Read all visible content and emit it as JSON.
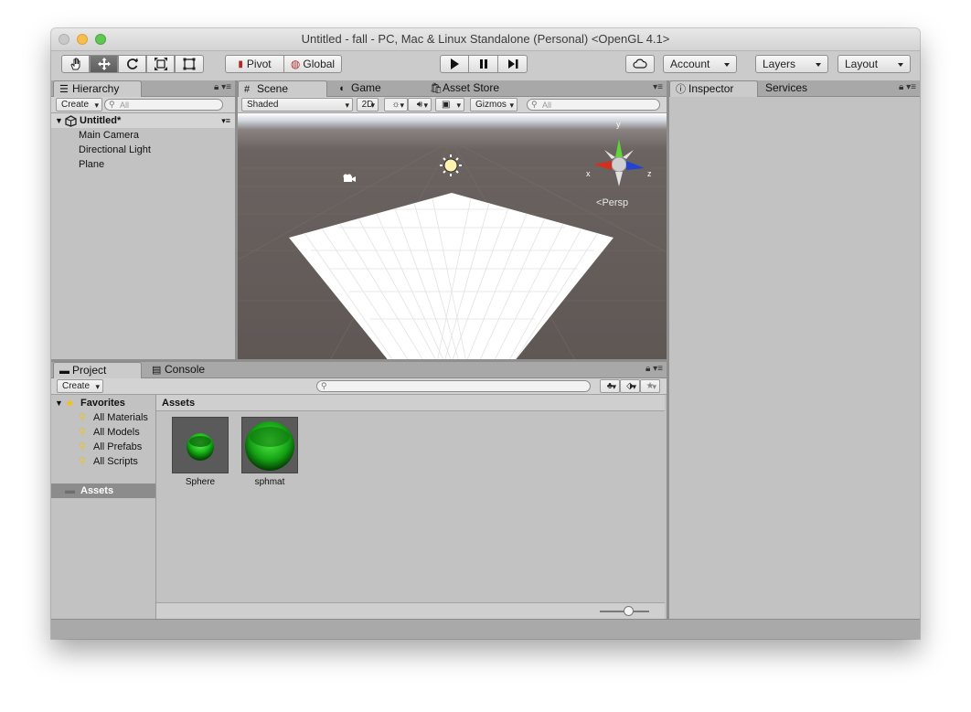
{
  "window": {
    "title": "Untitled - fall - PC, Mac & Linux Standalone (Personal) <OpenGL 4.1>"
  },
  "toolbar": {
    "tools": [
      "hand-icon",
      "move-icon",
      "rotate-icon",
      "scale-icon",
      "rect-icon"
    ],
    "pivot_label": "Pivot",
    "global_label": "Global",
    "account_label": "Account",
    "layers_label": "Layers",
    "layout_label": "Layout"
  },
  "hierarchy": {
    "tab_label": "Hierarchy",
    "create_label": "Create",
    "search_placeholder": "All",
    "scene_name": "Untitled*",
    "items": [
      "Main Camera",
      "Directional Light",
      "Plane"
    ]
  },
  "scene": {
    "tabs": [
      "Scene",
      "Game",
      "Asset Store"
    ],
    "shading_mode": "Shaded",
    "mode_2d": "2D",
    "gizmos_label": "Gizmos",
    "search_placeholder": "All",
    "persp_label": "Persp",
    "axis_labels": {
      "x": "x",
      "y": "y",
      "z": "z"
    }
  },
  "inspector": {
    "tabs": [
      "Inspector",
      "Services"
    ]
  },
  "project": {
    "tabs": [
      "Project",
      "Console"
    ],
    "create_label": "Create",
    "favorites_label": "Favorites",
    "favorites": [
      "All Materials",
      "All Models",
      "All Prefabs",
      "All Scripts"
    ],
    "assets_folder": "Assets",
    "assets_header": "Assets",
    "assets": [
      "Sphere",
      "sphmat"
    ]
  },
  "colors": {
    "accent_green": "#1fd01f",
    "selection": "#8c8c8c"
  }
}
